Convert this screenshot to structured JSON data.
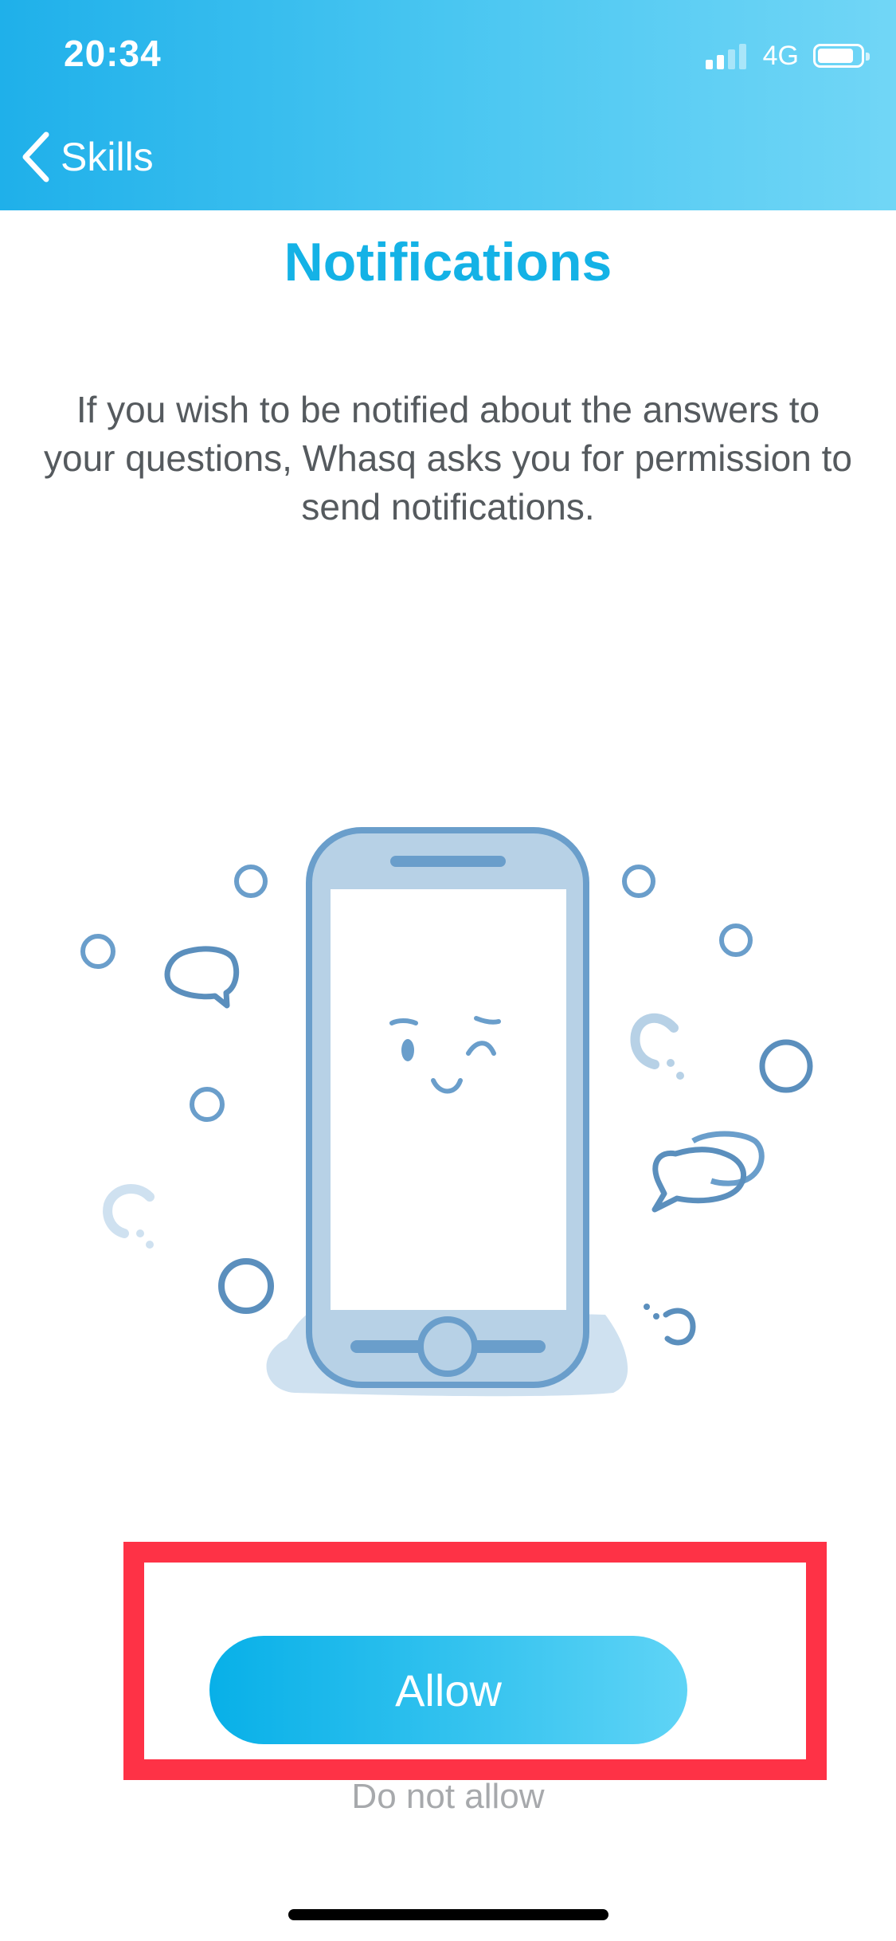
{
  "status_bar": {
    "time": "20:34",
    "network": "4G",
    "signal_bars_active": 2,
    "signal_bars_total": 4,
    "battery_level": 0.85
  },
  "nav": {
    "back_label": "Skills",
    "back_icon": "chevron-left-icon"
  },
  "content": {
    "title": "Notifications",
    "description": "If you wish to be notified about the answers to your questions, Whasq asks you for permission to send notifications."
  },
  "actions": {
    "allow_label": "Allow",
    "deny_label": "Do not allow"
  },
  "colors": {
    "header_gradient_start": "#1fb0ea",
    "header_gradient_end": "#71d6f6",
    "title": "#14b2e6",
    "highlight": "#fe3246",
    "illustration_stroke": "#6a9ecb",
    "illustration_fill": "#b7d1e6"
  }
}
